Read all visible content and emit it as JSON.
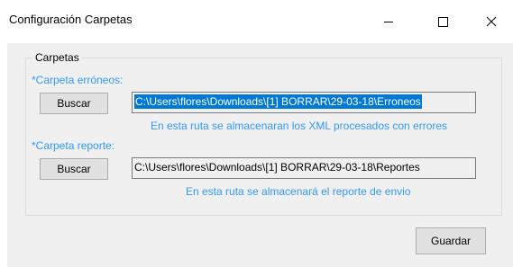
{
  "window": {
    "title": "Configuración Carpetas",
    "controls": {
      "minimize_icon": "minimize-icon",
      "maximize_icon": "maximize-icon",
      "close_icon": "close-icon"
    }
  },
  "group": {
    "legend": "Carpetas",
    "errors_folder": {
      "label": "*Carpeta erróneos:",
      "button_label": "Buscar",
      "path": "C:\\Users\\flores\\Downloads\\[1] BORRAR\\29-03-18\\Erroneos",
      "hint": "En esta ruta se almacenaran los XML procesados con errores"
    },
    "report_folder": {
      "label": "*Carpeta reporte:",
      "button_label": "Buscar",
      "path": "C:\\Users\\flores\\Downloads\\[1] BORRAR\\29-03-18\\Reportes",
      "hint": "En esta ruta se almacenará el reporte de envio"
    }
  },
  "footer": {
    "save_label": "Guardar"
  },
  "colors": {
    "label_blue": "#3399ff",
    "selection": "#0078d7",
    "client_bg": "#f0f0f0"
  }
}
